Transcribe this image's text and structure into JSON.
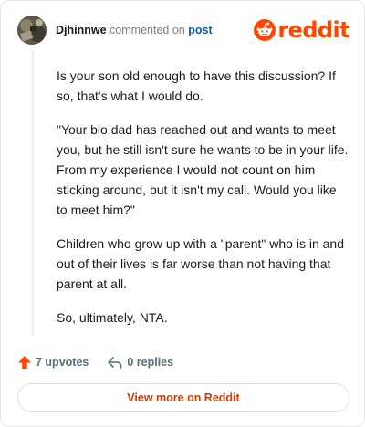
{
  "header": {
    "username": "Djhinnwe",
    "action_text": "commented on",
    "post_link": "post",
    "brand": "reddit"
  },
  "comment": {
    "paragraphs": [
      "Is your son old enough to have this discussion? If so, that's what I would do.",
      "\"Your bio dad has reached out and wants to meet you, but he still isn't sure he wants to be in your life. From my experience I would not count on him sticking around, but it isn't my call. Would you like to meet him?\"",
      "Children who grow up with a \"parent\" who is in and out of their lives is far worse than not having that parent at all.",
      "So, ultimately, NTA."
    ]
  },
  "actions": {
    "upvotes": "7 upvotes",
    "replies": "0 replies"
  },
  "footer": {
    "view_more": "View more on Reddit"
  },
  "colors": {
    "brand": "#ff4500",
    "link": "#0a5fb4",
    "action_text": "#576f76",
    "view_more_text": "#d93a00"
  }
}
